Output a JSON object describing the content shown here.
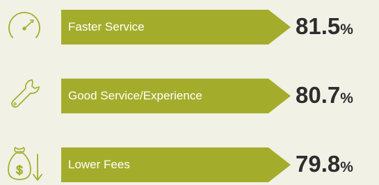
{
  "chart_data": {
    "type": "bar",
    "categories": [
      "Faster Service",
      "Good Service/Experience",
      "Lower Fees"
    ],
    "values": [
      81.5,
      80.7,
      79.8
    ],
    "unit": "%",
    "title": "",
    "xlabel": "",
    "ylabel": ""
  },
  "rows": [
    {
      "icon": "speedometer-icon",
      "label": "Faster Service",
      "value": "81.5",
      "unit": "%"
    },
    {
      "icon": "wrench-icon",
      "label": "Good Service/Experience",
      "value": "80.7",
      "unit": "%"
    },
    {
      "icon": "money-bag-down-arrow-icon",
      "label": "Lower Fees",
      "value": "79.8",
      "unit": "%"
    }
  ],
  "colors": {
    "background": "#f1f1e6",
    "bar": "#a4ad2b",
    "icon_stroke": "#a4ad2b",
    "label_text": "#ffffff",
    "value_text": "#2d2d2d"
  }
}
